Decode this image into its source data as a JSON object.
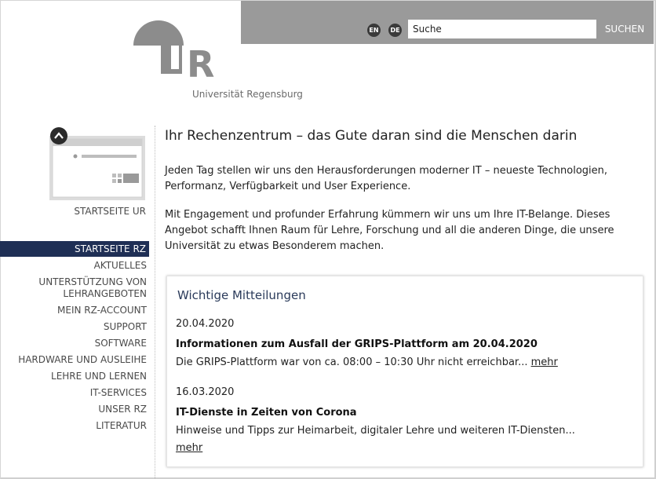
{
  "header": {
    "lang_en": "EN",
    "lang_de": "DE",
    "search_value": "Suche",
    "search_button": "SUCHEN",
    "logo_letters": "UR",
    "logo_subtitle": "Universität Regensburg"
  },
  "sidebar": {
    "startseite_ur": "STARTSEITE UR",
    "items": [
      {
        "label": "STARTSEITE RZ",
        "active": true
      },
      {
        "label": "AKTUELLES"
      },
      {
        "label": "UNTERSTÜTZUNG VON LEHRANGEBOTEN"
      },
      {
        "label": "MEIN RZ-ACCOUNT"
      },
      {
        "label": "SUPPORT"
      },
      {
        "label": "SOFTWARE"
      },
      {
        "label": "HARDWARE UND AUSLEIHE"
      },
      {
        "label": "LEHRE UND LERNEN"
      },
      {
        "label": "IT-SERVICES"
      },
      {
        "label": "UNSER RZ"
      },
      {
        "label": "LITERATUR"
      }
    ]
  },
  "main": {
    "title": "Ihr Rechenzentrum – das Gute daran sind die Menschen darin",
    "paragraph1": "Jeden Tag stellen wir uns den Herausforderungen moderner IT – neueste Technologien, Performanz, Verfügbarkeit und User Experience.",
    "paragraph2": "Mit Engagement und profunder Erfahrung kümmern wir uns um Ihre IT-Belange. Dieses Angebot schafft Ihnen Raum für Lehre, Forschung und all die anderen Dinge, die unsere Universität zu etwas Besonderem machen."
  },
  "news": {
    "title": "Wichtige Mitteilungen",
    "items": [
      {
        "date": "20.04.2020",
        "headline": "Informationen zum Ausfall der GRIPS-Plattform am 20.04.2020",
        "text": "Die GRIPS-Plattform war von ca. 08:00 – 10:30 Uhr nicht erreichbar...",
        "more": "mehr"
      },
      {
        "date": "16.03.2020",
        "headline": "IT-Dienste in Zeiten von Corona",
        "text": "Hinweise und Tipps zur Heimarbeit, digitaler Lehre und weiteren IT-Diensten...",
        "more": "mehr"
      }
    ]
  },
  "colors": {
    "topbar": "#9a9a9a",
    "nav_active": "#1f2f55",
    "logo_gray": "#8c8c8c"
  }
}
